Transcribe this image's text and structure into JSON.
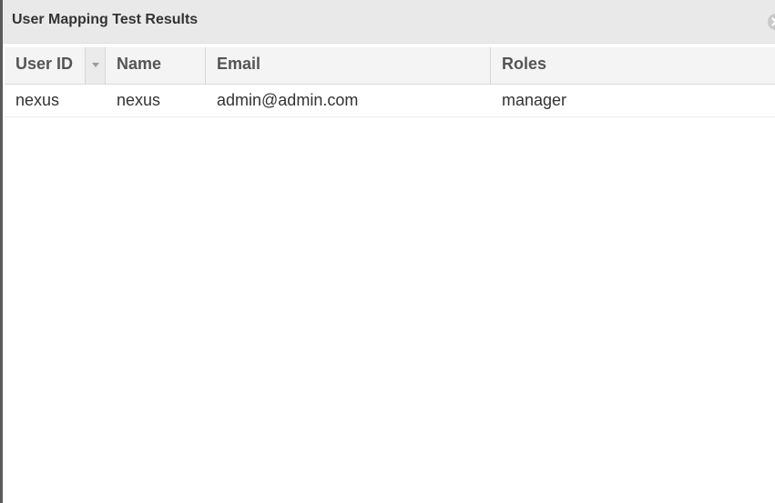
{
  "window": {
    "title": "User Mapping Test Results"
  },
  "table": {
    "columns": [
      "User ID",
      "Name",
      "Email",
      "Roles"
    ],
    "sort_column": "User ID",
    "rows": [
      {
        "user_id": "nexus",
        "name": "nexus",
        "email": "admin@admin.com",
        "roles": "manager"
      }
    ]
  },
  "icons": {
    "close": "close-icon",
    "sort": "caret-down-icon"
  },
  "colors": {
    "title_bar": "#e9e9e9",
    "header_bg": "#f4f4f4",
    "header_text": "#555555",
    "body_text": "#333333"
  }
}
